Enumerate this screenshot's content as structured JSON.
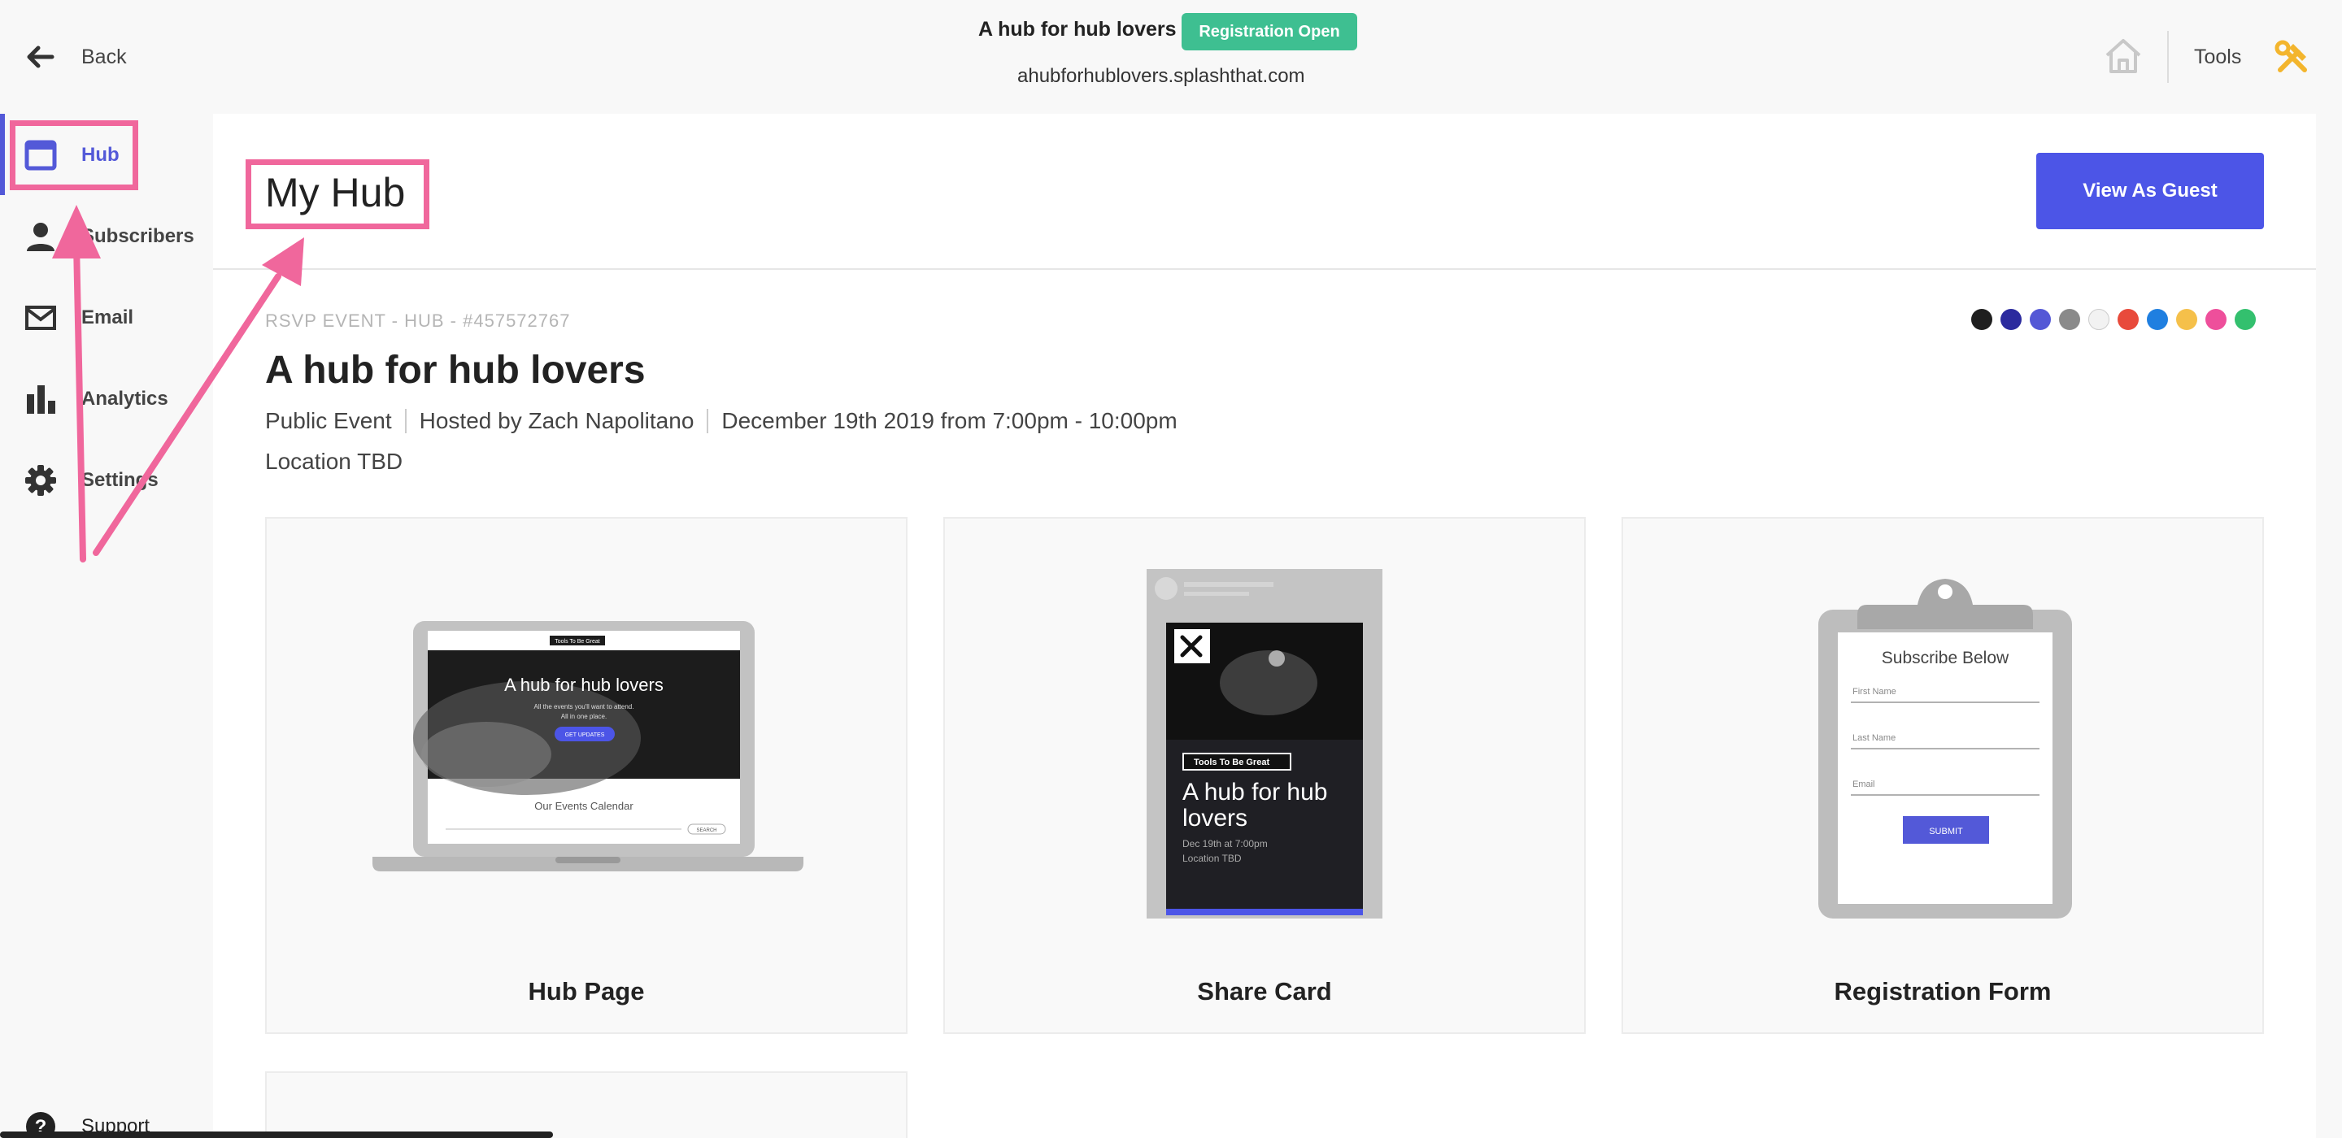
{
  "topbar": {
    "back_label": "Back",
    "event_title": "A hub for hub lovers",
    "registration_badge": "Registration Open",
    "event_url": "ahubforhublovers.splashthat.com",
    "tools_label": "Tools"
  },
  "sidebar": {
    "items": [
      {
        "label": "Hub",
        "icon": "hub-icon"
      },
      {
        "label": "Subscribers",
        "icon": "person-icon"
      },
      {
        "label": "Email",
        "icon": "envelope-icon"
      },
      {
        "label": "Analytics",
        "icon": "bar-chart-icon"
      },
      {
        "label": "Settings",
        "icon": "gear-icon"
      },
      {
        "label": "Support",
        "icon": "question-icon"
      }
    ]
  },
  "main": {
    "page_title": "My Hub",
    "view_as_guest": "View As Guest",
    "event_meta": "RSVP EVENT - HUB - #457572767",
    "event_name": "A hub for hub lovers",
    "details": [
      "Public Event",
      "Hosted by Zach Napolitano",
      "December 19th 2019 from 7:00pm - 10:00pm"
    ],
    "location": "Location TBD",
    "swatches": [
      "#1f1f1f",
      "#2b2a9e",
      "#5458d6",
      "#8a8a8a",
      "#f2f2f2",
      "#e84a3b",
      "#1f7fe0",
      "#f5c04a",
      "#ee4f9b",
      "#33c06e"
    ],
    "cards": [
      {
        "caption": "Hub Page"
      },
      {
        "caption": "Share Card"
      },
      {
        "caption": "Registration Form"
      }
    ]
  },
  "previews": {
    "hub": {
      "brand": "Tools To Be Great",
      "title": "A hub for hub lovers",
      "sub1": "All the events you'll want to attend.",
      "sub2": "All in one place.",
      "cta": "GET UPDATES",
      "calendar": "Our Events Calendar",
      "search": "SEARCH"
    },
    "share": {
      "brand": "Tools To Be Great",
      "title1": "A hub for hub",
      "title2": "lovers",
      "date": "Dec 19th at 7:00pm",
      "location": "Location TBD"
    },
    "form": {
      "heading": "Subscribe Below",
      "first": "First Name",
      "last": "Last Name",
      "email": "Email",
      "submit": "SUBMIT"
    }
  },
  "colors": {
    "accent": "#5359d8",
    "badge": "#3ebf91",
    "annotation": "#f0679c",
    "button": "#4c55e7"
  }
}
